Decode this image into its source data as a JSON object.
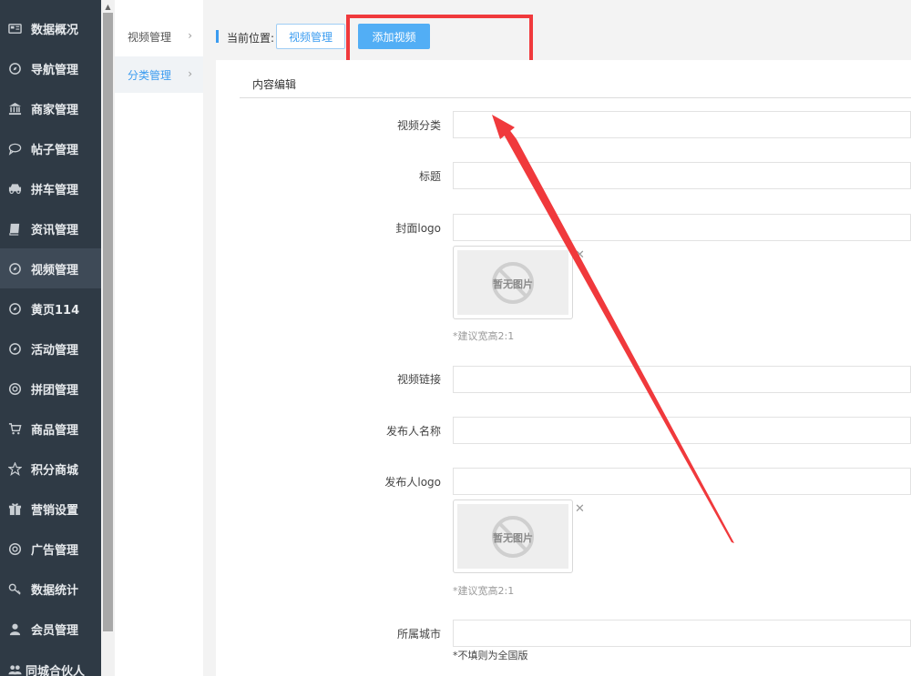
{
  "nav": {
    "items": [
      {
        "label": "数据概况",
        "icon": "dashboard-icon"
      },
      {
        "label": "导航管理",
        "icon": "compass-icon"
      },
      {
        "label": "商家管理",
        "icon": "bank-icon"
      },
      {
        "label": "帖子管理",
        "icon": "comment-icon"
      },
      {
        "label": "拼车管理",
        "icon": "car-icon"
      },
      {
        "label": "资讯管理",
        "icon": "book-icon"
      },
      {
        "label": "视频管理",
        "icon": "compass-icon"
      },
      {
        "label": "黄页114",
        "icon": "compass-icon"
      },
      {
        "label": "活动管理",
        "icon": "compass-icon"
      },
      {
        "label": "拼团管理",
        "icon": "lifebuoy-icon"
      },
      {
        "label": "商品管理",
        "icon": "cart-icon"
      },
      {
        "label": "积分商城",
        "icon": "star-icon"
      },
      {
        "label": "营销设置",
        "icon": "gift-icon"
      },
      {
        "label": "广告管理",
        "icon": "lifebuoy-icon"
      },
      {
        "label": "数据统计",
        "icon": "key-icon"
      },
      {
        "label": "会员管理",
        "icon": "user-icon"
      },
      {
        "label": "同城合伙人",
        "icon": "users-icon"
      }
    ],
    "active_index": 6
  },
  "subnav": {
    "items": [
      {
        "label": "视频管理",
        "chevron": "›"
      },
      {
        "label": "分类管理",
        "chevron": "›"
      }
    ],
    "active_index": 1
  },
  "breadcrumb": {
    "label": "当前位置:",
    "tab_video": "视频管理",
    "tab_add": "添加视频"
  },
  "panel": {
    "tab": "内容编辑",
    "fields": {
      "category": {
        "label": "视频分类",
        "value": ""
      },
      "title": {
        "label": "标题",
        "value": ""
      },
      "cover_logo": {
        "label": "封面logo",
        "value": "",
        "placeholder_text": "暂无图片",
        "hint": "*建议宽高2:1"
      },
      "video_link": {
        "label": "视频链接",
        "value": ""
      },
      "publisher_name": {
        "label": "发布人名称",
        "value": ""
      },
      "publisher_logo": {
        "label": "发布人logo",
        "value": "",
        "placeholder_text": "暂无图片",
        "hint": "*建议宽高2:1"
      },
      "city": {
        "label": "所属城市",
        "value": "",
        "hint": "*不填则为全国版"
      }
    }
  },
  "colors": {
    "nav_bg": "#2f3a45",
    "accent": "#3b9cf0",
    "annotation_red": "#f0393c"
  }
}
